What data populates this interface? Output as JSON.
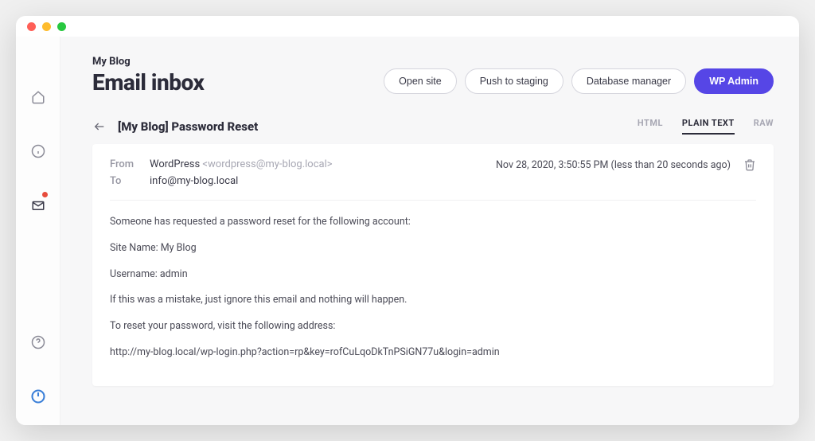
{
  "header": {
    "site_name": "My Blog",
    "title": "Email inbox",
    "actions": {
      "open_site": "Open site",
      "push_staging": "Push to staging",
      "db_manager": "Database manager",
      "wp_admin": "WP Admin"
    }
  },
  "email": {
    "subject": "[My Blog] Password Reset",
    "tabs": {
      "html": "HTML",
      "plain": "PLAIN TEXT",
      "raw": "RAW"
    },
    "meta": {
      "from_label": "From",
      "to_label": "To",
      "from_name": "WordPress",
      "from_addr": "<wordpress@my-blog.local>",
      "to_addr": "info@my-blog.local",
      "timestamp": "Nov 28, 2020, 3:50:55 PM (less than 20 seconds ago)"
    },
    "body": {
      "l1": "Someone has requested a password reset for the following account:",
      "l2": "Site Name: My Blog",
      "l3": "Username: admin",
      "l4": "If this was a mistake, just ignore this email and nothing will happen.",
      "l5": "To reset your password, visit the following address:",
      "l6": "http://my-blog.local/wp-login.php?action=rp&key=rofCuLqoDkTnPSiGN77u&login=admin"
    }
  }
}
